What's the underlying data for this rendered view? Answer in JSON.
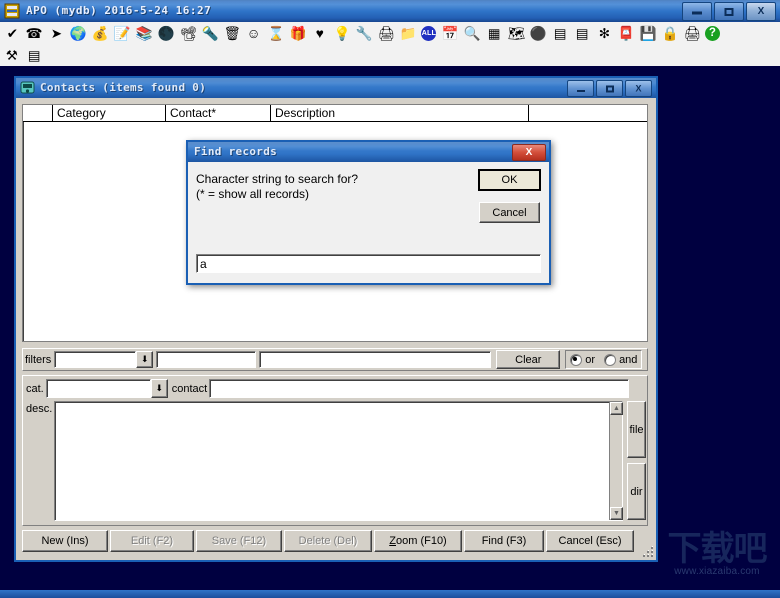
{
  "window": {
    "title": "APO (mydb) 2016-5-24 16:27",
    "icon": "database-app-icon",
    "controls": {
      "minimize": "minimize-icon",
      "maximize": "maximize-icon",
      "close": "X"
    }
  },
  "toolbar": {
    "row1": [
      {
        "name": "check-icon",
        "glyph": "✔"
      },
      {
        "name": "telephone-icon",
        "glyph": "☎"
      },
      {
        "name": "arrow-right-icon",
        "glyph": "➤"
      },
      {
        "name": "globe-icon",
        "glyph": "🌍"
      },
      {
        "name": "money-bag-icon",
        "glyph": "💰"
      },
      {
        "name": "notepad-pen-icon",
        "glyph": "📝"
      },
      {
        "name": "books-icon",
        "glyph": "📚"
      },
      {
        "name": "pie-chart-icon",
        "glyph": "🌑"
      },
      {
        "name": "projector-icon",
        "glyph": "📽"
      },
      {
        "name": "desk-lamp-icon",
        "glyph": "🔦"
      },
      {
        "name": "trash-bin-icon",
        "glyph": "🗑"
      },
      {
        "name": "smiley-icon",
        "glyph": "☺"
      },
      {
        "name": "hourglass-icon",
        "glyph": "⌛"
      },
      {
        "name": "gift-icon",
        "glyph": "🎁"
      },
      {
        "name": "heart-icon",
        "glyph": "♥"
      },
      {
        "name": "lightbulb-icon",
        "glyph": "💡"
      },
      {
        "name": "wrench-icon",
        "glyph": "🔧"
      },
      {
        "name": "printer-icon",
        "glyph": "🖨"
      },
      {
        "name": "folder-icon",
        "glyph": "📁"
      },
      {
        "name": "all-badge-icon",
        "glyph": "ALL"
      },
      {
        "name": "calendar-icon",
        "glyph": "📅"
      },
      {
        "name": "binoculars-icon",
        "glyph": "🔍"
      },
      {
        "name": "table-grid-icon",
        "glyph": "▦"
      },
      {
        "name": "treasure-map-icon",
        "glyph": "🗺"
      },
      {
        "name": "network-icon",
        "glyph": "⚫"
      },
      {
        "name": "terminal-blue-icon",
        "glyph": "▤"
      },
      {
        "name": "terminal-green-icon",
        "glyph": "▤"
      },
      {
        "name": "asterisk-icon",
        "glyph": "✻"
      },
      {
        "name": "mailbox-icon",
        "glyph": "📮"
      },
      {
        "name": "floppy-icon",
        "glyph": "💾"
      },
      {
        "name": "lock-bag-icon",
        "glyph": "🔒"
      },
      {
        "name": "scanner-icon",
        "glyph": "🖨"
      },
      {
        "name": "help-icon",
        "glyph": "?"
      }
    ],
    "row2": [
      {
        "name": "tools-icon",
        "glyph": "⚒"
      },
      {
        "name": "console-window-icon",
        "glyph": "▤"
      }
    ]
  },
  "child_window": {
    "title": "Contacts (items found  0)",
    "icon": "telephone-icon",
    "controls": {
      "minimize": "minimize-icon",
      "maximize": "maximize-icon",
      "close": "X"
    },
    "grid": {
      "columns": [
        "",
        "Category",
        "Contact*",
        "Description"
      ],
      "rows": []
    },
    "filters": {
      "label": "filters",
      "combo_value": "",
      "field2_value": "",
      "field3_value": "",
      "clear_label": "Clear",
      "mode_selected": "or",
      "mode_options": [
        "or",
        "and"
      ]
    },
    "detail": {
      "cat_label": "cat.",
      "cat_value": "",
      "contact_label": "contact",
      "contact_value": "",
      "desc_label": "desc.",
      "desc_value": "",
      "side_buttons": [
        "file",
        "dir"
      ]
    },
    "buttons": [
      {
        "label": "New (Ins)",
        "name": "new-button",
        "disabled": false,
        "accel": ""
      },
      {
        "label": "Edit (F2)",
        "name": "edit-button",
        "disabled": true,
        "accel": ""
      },
      {
        "label": "Save (F12)",
        "name": "save-button",
        "disabled": true,
        "accel": ""
      },
      {
        "label": "Delete (Del)",
        "name": "delete-button",
        "disabled": true,
        "accel": ""
      },
      {
        "label": "Zoom (F10)",
        "name": "zoom-button",
        "disabled": false,
        "accel": "Z"
      },
      {
        "label": "Find (F3)",
        "name": "find-button",
        "disabled": false,
        "accel": ""
      },
      {
        "label": "Cancel (Esc)",
        "name": "cancel-button",
        "disabled": false,
        "accel": ""
      }
    ]
  },
  "dialog": {
    "title": "Find records",
    "close_label": "X",
    "prompt_line1": "Character string to search for?",
    "prompt_line2": "(* = show all records)",
    "input_value": "a",
    "ok_label": "OK",
    "cancel_label": "Cancel"
  },
  "watermark": {
    "cn": "下载吧",
    "url": "www.xiazaiba.com"
  }
}
